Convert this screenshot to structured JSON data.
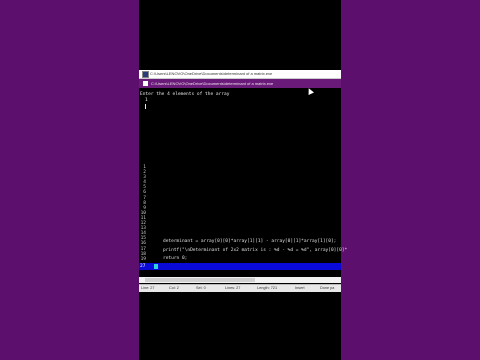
{
  "window": {
    "title": "C:\\Users\\LENOVO\\OneDrive\\Documents\\determinant of a matrix.exe"
  },
  "console": {
    "header": "C:\\Users\\LENOVO\\OneDrive\\Documents\\determinant of a matrix.exe",
    "prompt": "Enter the 4 elements of the array",
    "input": "1"
  },
  "code": {
    "lines": [
      "determinant = array[0][0]*array[1][1] - array[0][1]*array[1][0];",
      "printf(\"\\nDeterminant of 2x2 matrix is : %d - %d = %d\", array[0][0]*",
      "",
      "return 0;"
    ],
    "gutter": [
      "1",
      "2",
      "3",
      "4",
      "5",
      "6",
      "7",
      "8",
      "9",
      "10",
      "11",
      "12",
      "13",
      "14",
      "15",
      "16",
      "17",
      "18",
      "19",
      "20",
      "21",
      "22",
      "23",
      "24",
      "25",
      "26"
    ],
    "current_line": "27"
  },
  "status": {
    "line": "Line: 27",
    "col": "Col: 2",
    "sel": "Sel: 0",
    "lines": "Lines: 27",
    "length": "Length: 721",
    "mode": "Insert",
    "parse": "Done pa"
  }
}
